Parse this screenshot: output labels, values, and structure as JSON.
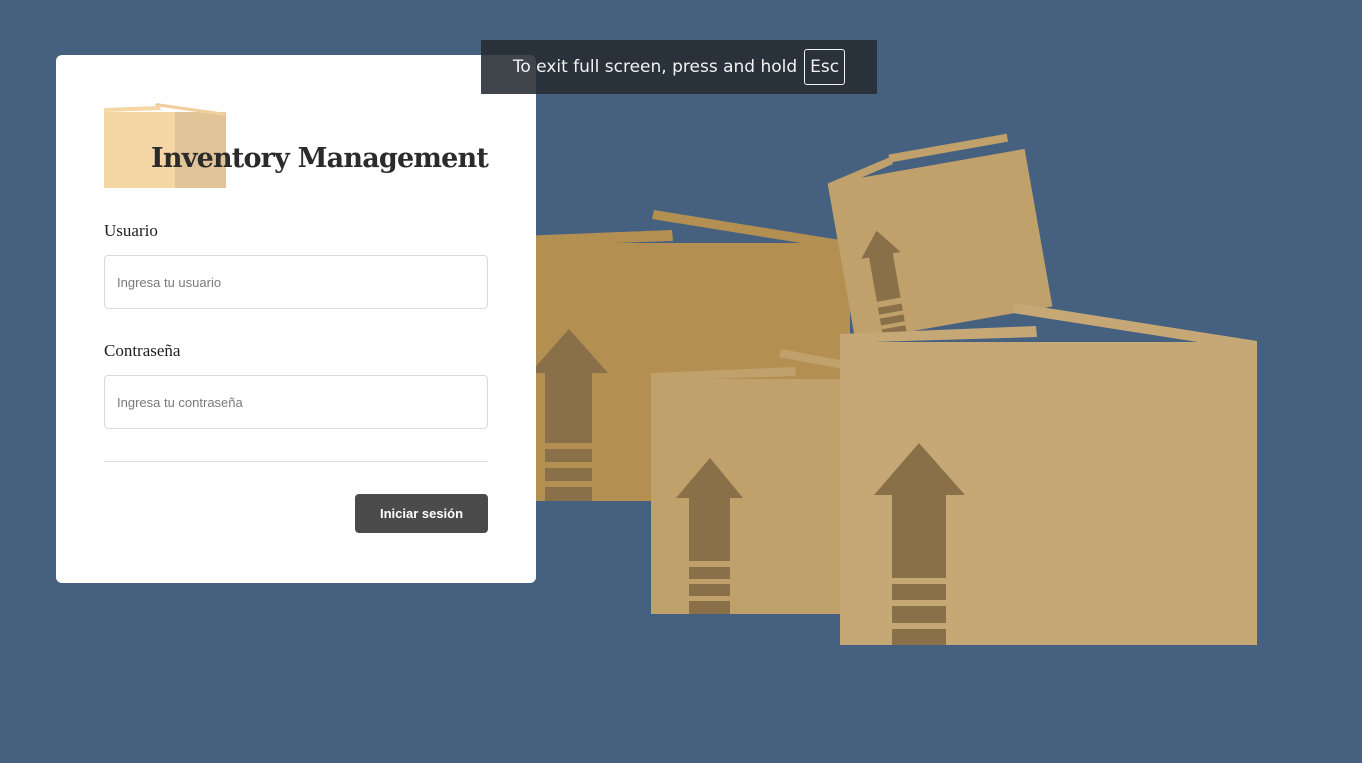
{
  "app": {
    "title": "Inventory Management"
  },
  "form": {
    "username_label": "Usuario",
    "username_placeholder": "Ingresa tu usuario",
    "username_value": "",
    "password_label": "Contraseña",
    "password_placeholder": "Ingresa tu contraseña",
    "password_value": "",
    "submit_label": "Iniciar sesión"
  },
  "fullscreen_notice": {
    "message": "To exit full screen, press and hold",
    "key": "Esc"
  },
  "icons": {
    "logo": "cardboard-box-icon",
    "illustration": "cardboard-boxes-illustration"
  },
  "colors": {
    "background": "#46617f",
    "card": "#ffffff",
    "button": "#4b4b4b",
    "box_dark": "#b48f52",
    "box_mid": "#c0a06b",
    "box_light": "#c6a877",
    "arrow": "#8a7048"
  }
}
